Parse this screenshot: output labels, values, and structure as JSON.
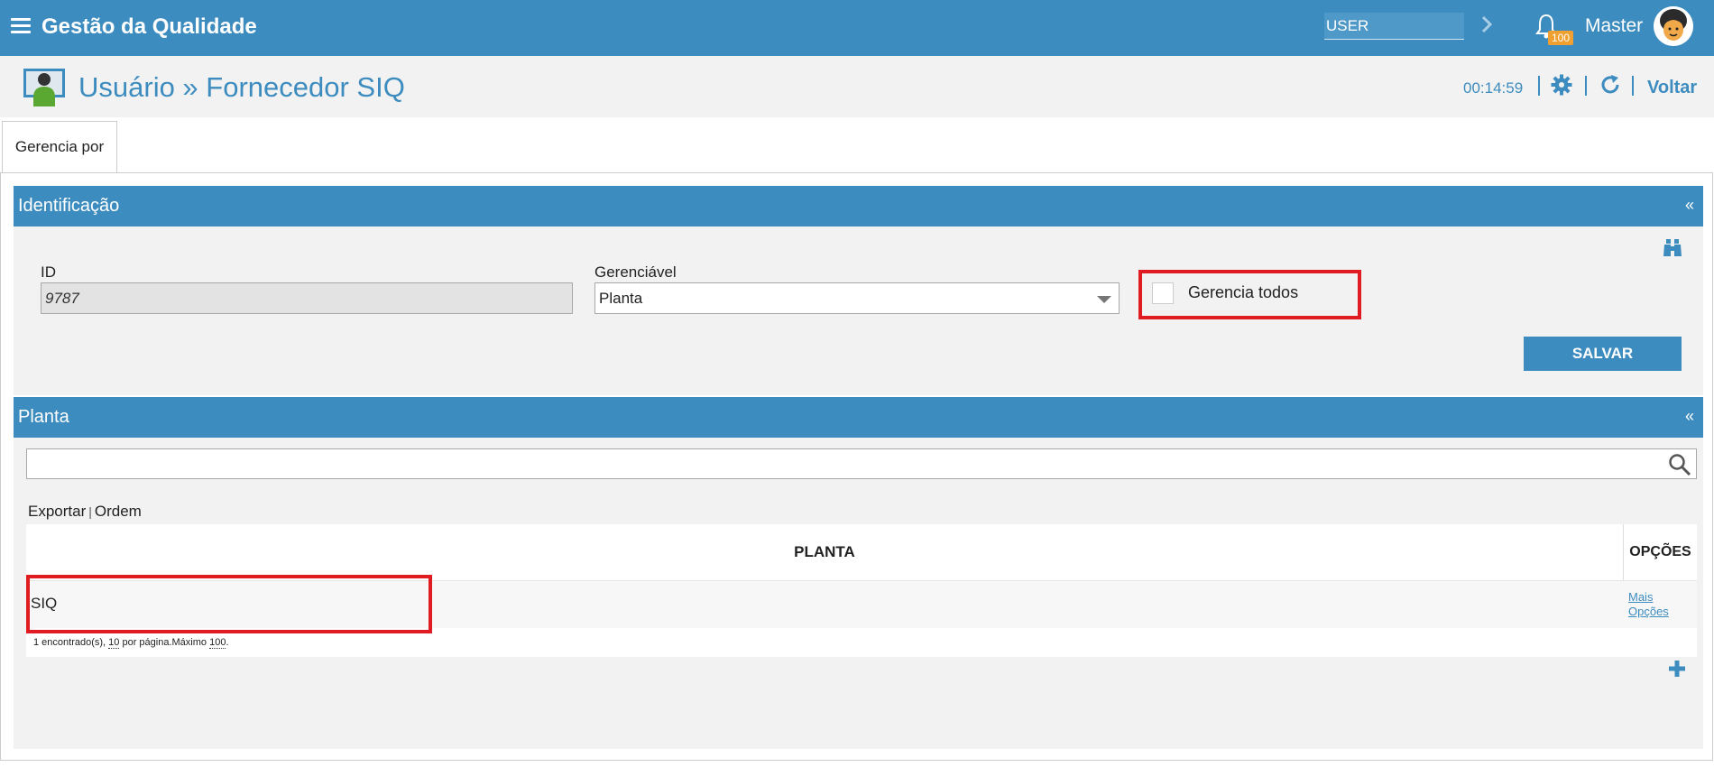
{
  "topbar": {
    "app_title": "Gestão da Qualidade",
    "user_placeholder": "USER",
    "notifications_count": "100",
    "username": "Master"
  },
  "header": {
    "title": "Usuário » Fornecedor SIQ",
    "timer": "00:14:59",
    "back_label": "Voltar"
  },
  "tabs": [
    {
      "label": "Gerencia por",
      "active": true
    }
  ],
  "identificacao": {
    "title": "Identificação",
    "collapse": "«",
    "id_label": "ID",
    "id_value": "9787",
    "gerenciavel_label": "Gerenciável",
    "gerenciavel_value": "Planta",
    "gerencia_todos_label": "Gerencia todos",
    "save_label": "SALVAR"
  },
  "planta": {
    "title": "Planta",
    "collapse": "«",
    "export_label": "Exportar",
    "order_label": "Ordem",
    "columns": [
      "PLANTA",
      "OPÇÕES"
    ],
    "rows": [
      {
        "planta": "SIQ",
        "options_line1": "Mais",
        "options_line2": "Opções"
      }
    ],
    "footer_prefix": "1 encontrado(s), ",
    "footer_per_page": "10",
    "footer_mid": " por página.Máximo ",
    "footer_max": "100",
    "footer_suffix": "."
  },
  "colors": {
    "primary": "#3d8cbf",
    "highlight": "#e11b22",
    "badge": "#f0a030"
  }
}
